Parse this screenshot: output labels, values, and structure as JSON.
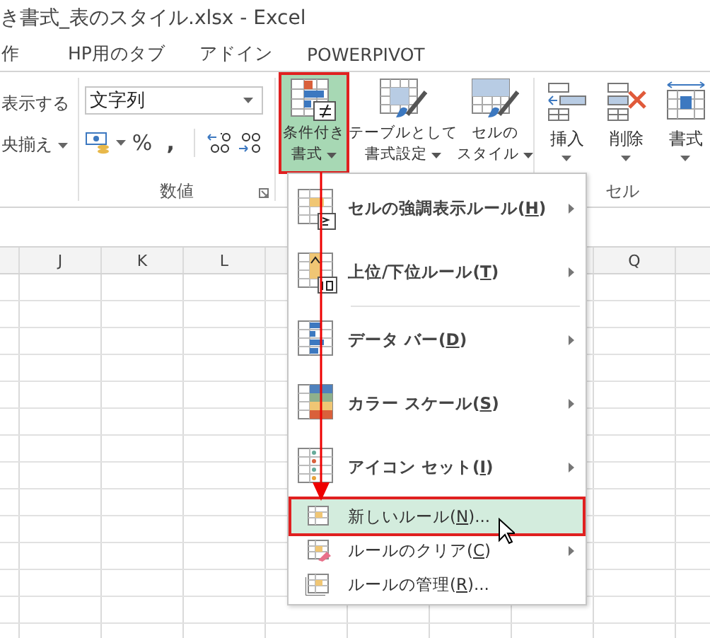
{
  "window": {
    "title": "き書式_表のスタイル.xlsx - Excel"
  },
  "tabs": [
    {
      "label": "作"
    },
    {
      "label": "HP用のタブ"
    },
    {
      "label": "アドイン"
    },
    {
      "label": "POWERPIVOT"
    }
  ],
  "ribbon": {
    "left_group": {
      "items": [
        "表示する",
        "央揃え"
      ]
    },
    "number_group": {
      "format_value": "文字列",
      "symbols": [
        "%",
        ","
      ],
      "label": "数値"
    },
    "styles_group": [
      {
        "lines": [
          "条件付き",
          "書式"
        ],
        "selected": true
      },
      {
        "lines": [
          "テーブルとして",
          "書式設定"
        ],
        "selected": false
      },
      {
        "lines": [
          "セルの",
          "スタイル"
        ],
        "selected": false
      }
    ],
    "cells_group": {
      "buttons": [
        "挿入",
        "削除",
        "書式"
      ],
      "label": "セル"
    }
  },
  "columns": [
    {
      "label": "J"
    },
    {
      "label": "K"
    },
    {
      "label": "L"
    },
    {
      "label": "Q"
    }
  ],
  "menu": [
    {
      "kind": "large",
      "prefix": "セルの強調表示ルール(",
      "key": "H",
      "suffix": ")",
      "submenu": true,
      "selected": false
    },
    {
      "kind": "large",
      "prefix": "上位/下位ルール(",
      "key": "T",
      "suffix": ")",
      "submenu": true,
      "selected": false
    },
    {
      "kind": "large",
      "prefix": "データ バー(",
      "key": "D",
      "suffix": ")",
      "submenu": true,
      "selected": false
    },
    {
      "kind": "large",
      "prefix": "カラー スケール(",
      "key": "S",
      "suffix": ")",
      "submenu": true,
      "selected": false
    },
    {
      "kind": "large",
      "prefix": "アイコン セット(",
      "key": "I",
      "suffix": ")",
      "submenu": true,
      "selected": false
    },
    {
      "kind": "small",
      "prefix": "新しいルール(",
      "key": "N",
      "suffix": ")...",
      "submenu": false,
      "selected": true
    },
    {
      "kind": "small",
      "prefix": "ルールのクリア(",
      "key": "C",
      "suffix": ")",
      "submenu": true,
      "selected": false
    },
    {
      "kind": "small",
      "prefix": "ルールの管理(",
      "key": "R",
      "suffix": ")...",
      "submenu": false,
      "selected": false
    }
  ]
}
